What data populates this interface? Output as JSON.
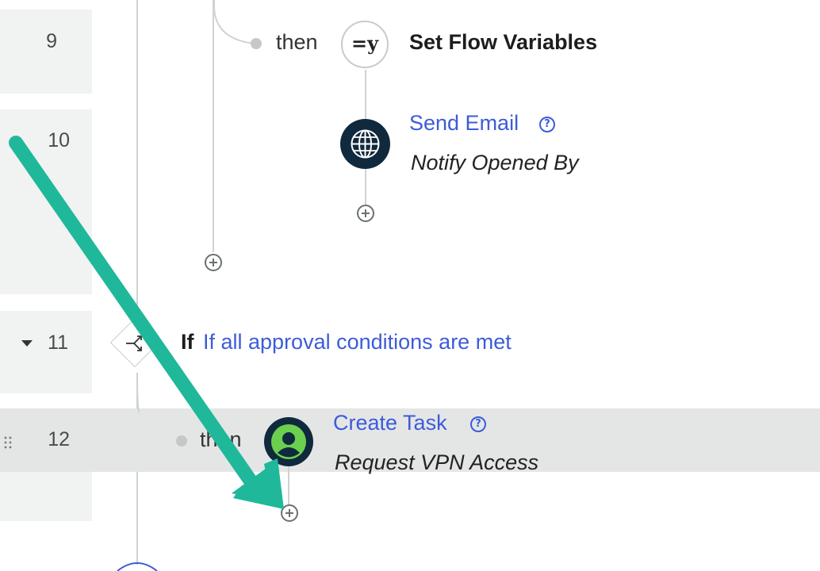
{
  "steps": {
    "s9": {
      "number": "9"
    },
    "s10": {
      "number": "10"
    },
    "s11": {
      "number": "11"
    },
    "s12": {
      "number": "12"
    }
  },
  "flow": {
    "then_label": "then",
    "set_vars": {
      "icon_text": "=y",
      "title": "Set Flow Variables"
    },
    "send_email": {
      "title": "Send Email",
      "subtitle": "Notify Opened By",
      "help": "?"
    },
    "condition": {
      "keyword": "If",
      "text": "If all approval conditions are met"
    },
    "create_task": {
      "title": "Create Task",
      "subtitle": "Request VPN Access",
      "help": "?"
    }
  },
  "colors": {
    "link": "#3d5bd9",
    "arrow": "#1fb89a",
    "icon_dark": "#10293d",
    "task_green": "#6bcf4f"
  }
}
